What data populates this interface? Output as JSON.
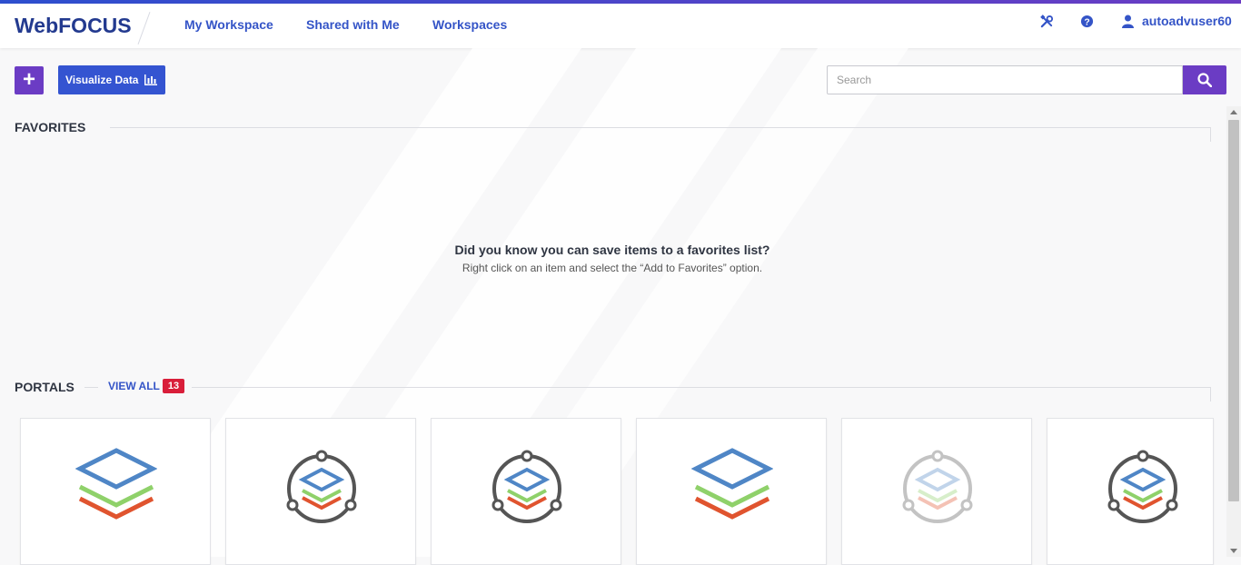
{
  "header": {
    "logo": "WebFOCUS",
    "nav": [
      "My Workspace",
      "Shared with Me",
      "Workspaces"
    ],
    "icons": [
      "tools-icon",
      "help-icon",
      "user-icon"
    ],
    "username": "autoadvuser60"
  },
  "toolbar": {
    "add_label": "+",
    "visualize_label": "Visualize Data",
    "search_placeholder": "Search"
  },
  "favorites": {
    "title": "FAVORITES",
    "tip_title": "Did you know you can save items to a favorites list?",
    "tip_text": "Right click on an item and select the “Add to Favorites” option."
  },
  "portals": {
    "title": "PORTALS",
    "view_all": "VIEW ALL",
    "count": "13",
    "cards": [
      {
        "icon": "layers-icon",
        "faded": false
      },
      {
        "icon": "portal-orbit-icon",
        "faded": false
      },
      {
        "icon": "portal-orbit-icon",
        "faded": false
      },
      {
        "icon": "layers-icon",
        "faded": false
      },
      {
        "icon": "portal-orbit-icon",
        "faded": true
      },
      {
        "icon": "portal-orbit-icon",
        "faded": false
      }
    ]
  },
  "colors": {
    "brand_blue": "#3454c7",
    "brand_purple": "#6b3cc4",
    "badge_red": "#d91e3a",
    "layer_blue": "#4f86c6",
    "layer_green": "#8fd16a",
    "layer_red": "#e0542f"
  }
}
